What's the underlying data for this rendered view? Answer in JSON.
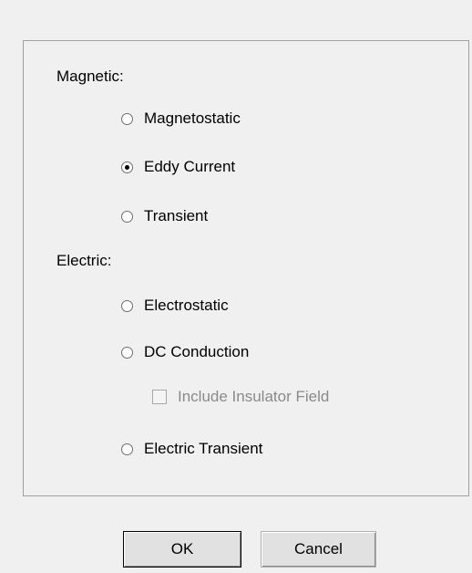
{
  "magnetic": {
    "label": "Magnetic:",
    "options": [
      {
        "label": "Magnetostatic",
        "selected": false
      },
      {
        "label": "Eddy Current",
        "selected": true
      },
      {
        "label": "Transient",
        "selected": false
      }
    ]
  },
  "electric": {
    "label": "Electric:",
    "options": [
      {
        "label": "Electrostatic",
        "selected": false
      },
      {
        "label": "DC Conduction",
        "selected": false
      },
      {
        "label": "Electric Transient",
        "selected": false
      }
    ],
    "include_insulator_field": {
      "label": "Include Insulator Field",
      "checked": false,
      "enabled": false
    }
  },
  "buttons": {
    "ok_label": "OK",
    "cancel_label": "Cancel"
  }
}
